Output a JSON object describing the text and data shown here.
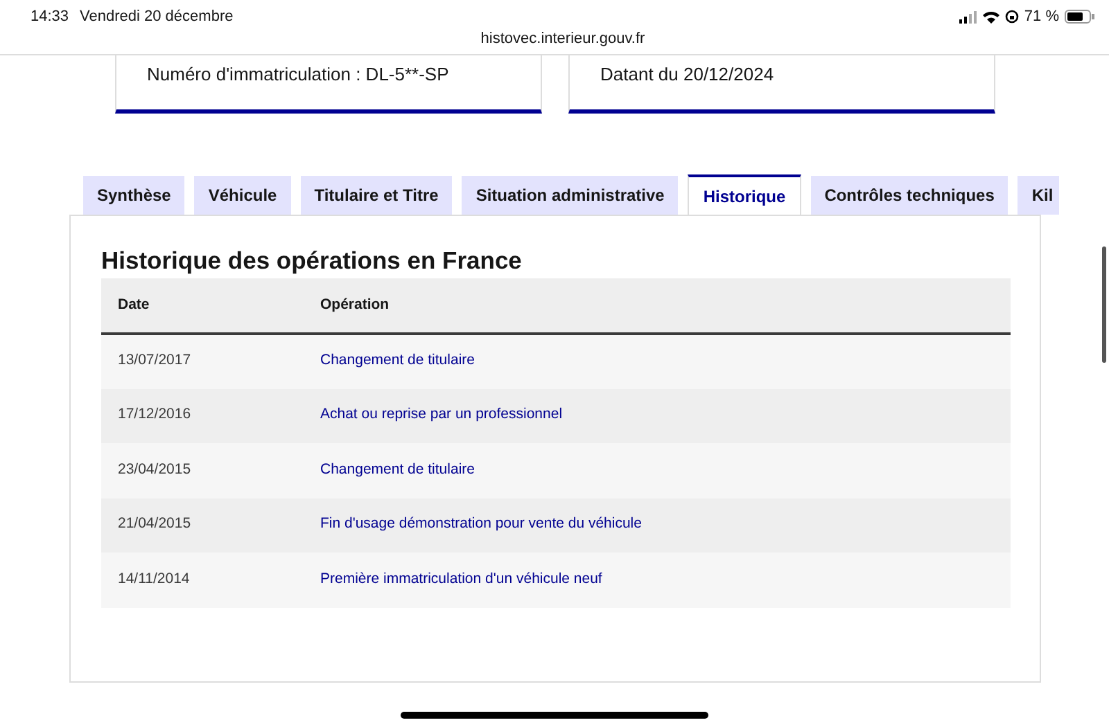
{
  "status_bar": {
    "time": "14:33",
    "date": "Vendredi 20 décembre",
    "url": "histovec.interieur.gouv.fr",
    "battery": "71 %"
  },
  "cards": [
    {
      "text": "Numéro d'immatriculation : DL-5**-SP"
    },
    {
      "text": "Datant du 20/12/2024"
    }
  ],
  "tabs": [
    {
      "label": "Synthèse",
      "selected": false
    },
    {
      "label": "Véhicule",
      "selected": false
    },
    {
      "label": "Titulaire et Titre",
      "selected": false
    },
    {
      "label": "Situation administrative",
      "selected": false
    },
    {
      "label": "Historique",
      "selected": true
    },
    {
      "label": "Contrôles techniques",
      "selected": false
    },
    {
      "label": "Kil",
      "selected": false
    }
  ],
  "panel": {
    "title": "Historique des opérations en France",
    "table": {
      "columns": [
        "Date",
        "Opération"
      ],
      "rows": [
        [
          "13/07/2017",
          "Changement de titulaire"
        ],
        [
          "17/12/2016",
          "Achat ou reprise par un professionnel"
        ],
        [
          "23/04/2015",
          "Changement de titulaire"
        ],
        [
          "21/04/2015",
          "Fin d'usage démonstration pour vente du véhicule"
        ],
        [
          "14/11/2014",
          "Première immatriculation d'un véhicule neuf"
        ]
      ]
    }
  }
}
